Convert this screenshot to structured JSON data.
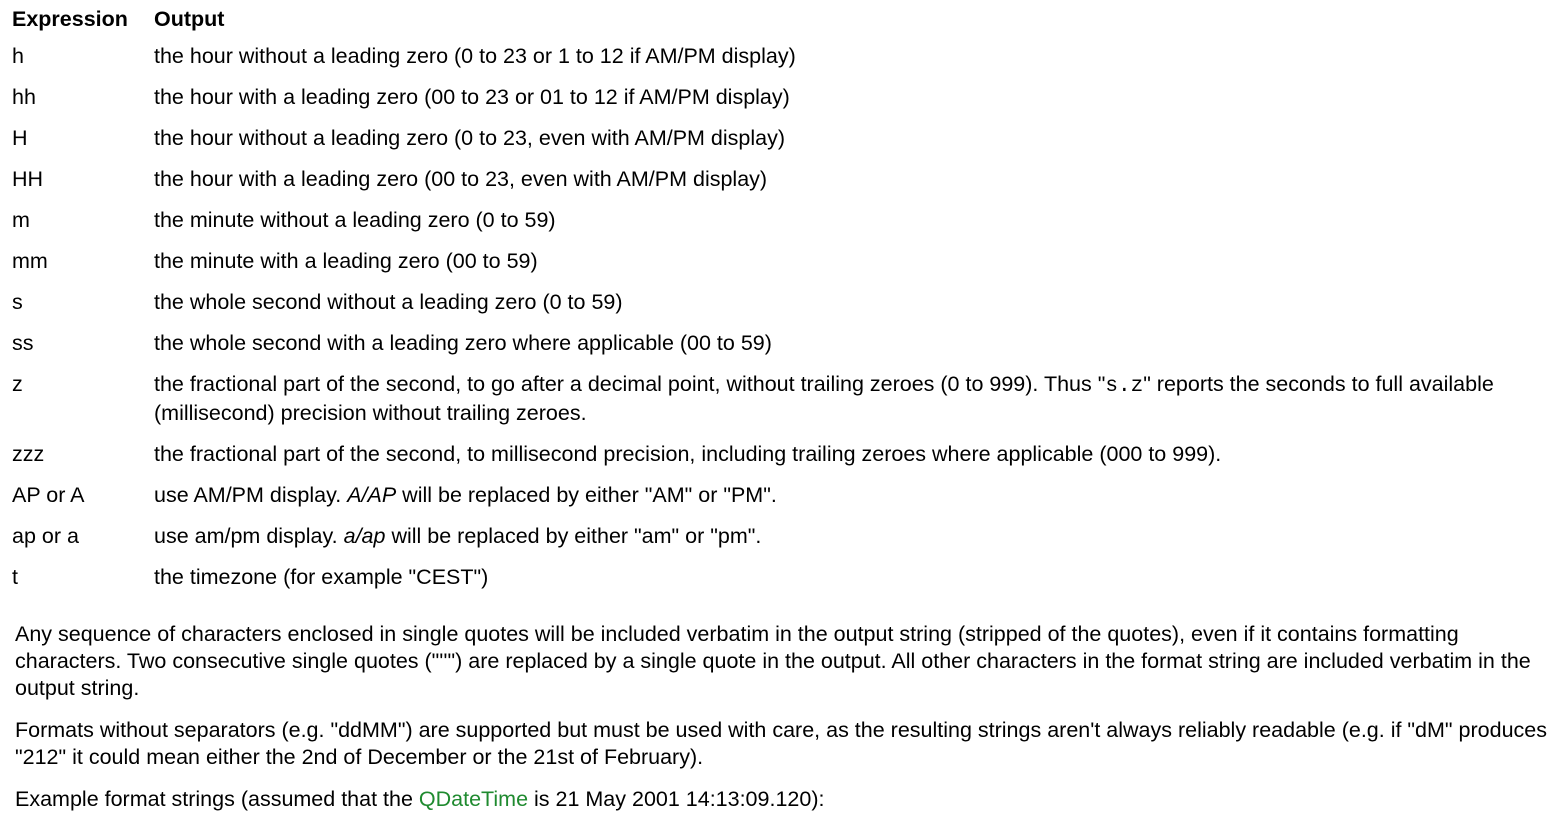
{
  "table": {
    "headers": {
      "expression": "Expression",
      "output": "Output"
    },
    "rows": [
      {
        "expr": "h",
        "output": "the hour without a leading zero (0 to 23 or 1 to 12 if AM/PM display)"
      },
      {
        "expr": "hh",
        "output": "the hour with a leading zero (00 to 23 or 01 to 12 if AM/PM display)"
      },
      {
        "expr": "H",
        "output": "the hour without a leading zero (0 to 23, even with AM/PM display)"
      },
      {
        "expr": "HH",
        "output": "the hour with a leading zero (00 to 23, even with AM/PM display)"
      },
      {
        "expr": "m",
        "output": "the minute without a leading zero (0 to 59)"
      },
      {
        "expr": "mm",
        "output": "the minute with a leading zero (00 to 59)"
      },
      {
        "expr": "s",
        "output": "the whole second without a leading zero (0 to 59)"
      },
      {
        "expr": "ss",
        "output": "the whole second with a leading zero where applicable (00 to 59)"
      },
      {
        "expr": "z",
        "output_a": "the fractional part of the second, to go after a decimal point, without trailing zeroes (0 to 999). Thus \"",
        "output_code": "s.z",
        "output_b": "\" reports the seconds to full available (millisecond) precision without trailing zeroes."
      },
      {
        "expr": "zzz",
        "output": "the fractional part of the second, to millisecond precision, including trailing zeroes where applicable (000 to 999)."
      },
      {
        "expr": "AP or A",
        "output_a": "use AM/PM display. ",
        "output_italic": "A/AP",
        "output_b": " will be replaced by either \"AM\" or \"PM\"."
      },
      {
        "expr": "ap or a",
        "output_a": "use am/pm display. ",
        "output_italic": "a/ap",
        "output_b": " will be replaced by either \"am\" or \"pm\"."
      },
      {
        "expr": "t",
        "output": "the timezone (for example \"CEST\")"
      }
    ]
  },
  "paragraphs": {
    "p1": "Any sequence of characters enclosed in single quotes will be included verbatim in the output string (stripped of the quotes), even if it contains formatting characters. Two consecutive single quotes (\"''\") are replaced by a single quote in the output. All other characters in the format string are included verbatim in the output string.",
    "p2": "Formats without separators (e.g. \"ddMM\") are supported but must be used with care, as the resulting strings aren't always reliably readable (e.g. if \"dM\" produces \"212\" it could mean either the 2nd of December or the 21st of February).",
    "p3_a": "Example format strings (assumed that the ",
    "p3_link": "QDateTime",
    "p3_b": " is 21 May 2001 14:13:09.120):"
  },
  "colors": {
    "link": "#1f8a2f",
    "text": "#000000",
    "background": "#ffffff"
  }
}
